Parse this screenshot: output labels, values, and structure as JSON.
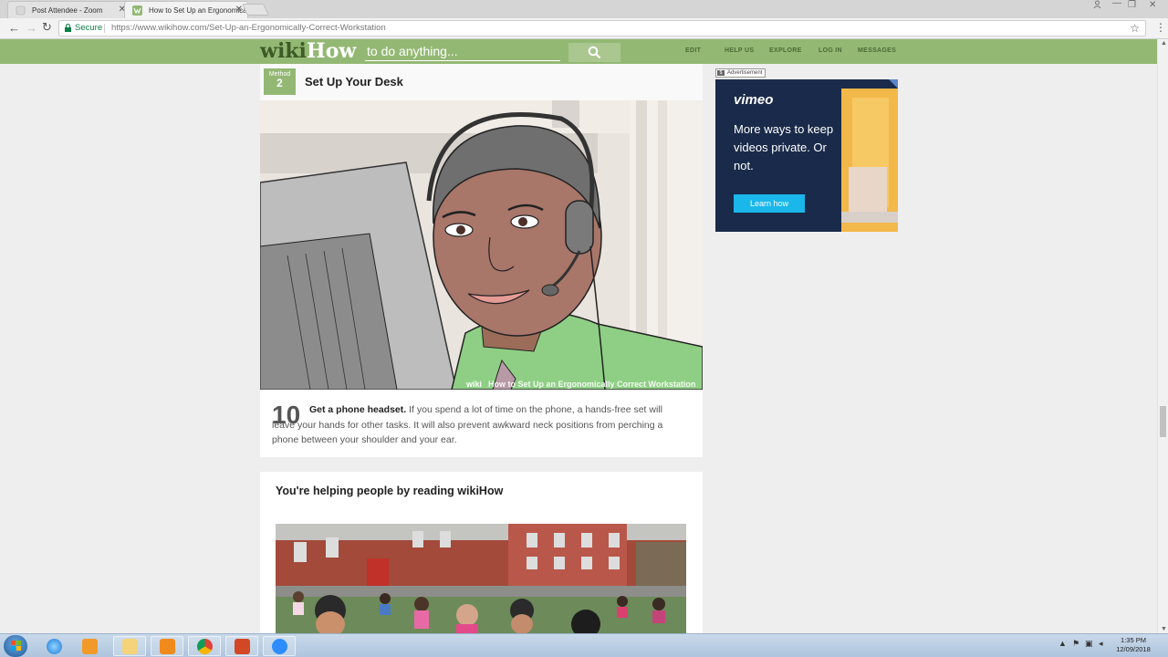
{
  "browser": {
    "tabs": [
      {
        "title": "Post Attendee - Zoom",
        "active": false
      },
      {
        "title": "How to Set Up an Ergonomically",
        "active": true
      }
    ],
    "secure_label": "Secure",
    "url": "https://www.wikihow.com/Set-Up-an-Ergonomically-Correct-Workstation"
  },
  "site": {
    "logo_wiki": "wiki",
    "logo_how": "How",
    "search_placeholder": "to do anything...",
    "nav": [
      "EDIT",
      "HELP US",
      "EXPLORE",
      "LOG IN",
      "MESSAGES"
    ],
    "brand_color": "#93b874"
  },
  "method": {
    "label": "Method",
    "number": "2",
    "title": "Set Up Your Desk"
  },
  "step": {
    "number": "10",
    "bold": "Get a phone headset.",
    "text": " If you spend a lot of time on the phone, a hands-free set will leave your hands for other tasks. It will also prevent awkward neck positions from perching a phone between your shoulder and your ear.",
    "image_watermark": "How to Set Up an Ergonomically Correct Workstation",
    "watermark_brand": "wiki"
  },
  "helping": {
    "title": "You're helping people by reading wikiHow"
  },
  "ad": {
    "label": "Advertisement",
    "brand": "vimeo",
    "copy": "More ways to keep videos private. Or not.",
    "button": "Learn how"
  },
  "taskbar": {
    "time": "1:35 PM",
    "date": "12/09/2018"
  }
}
